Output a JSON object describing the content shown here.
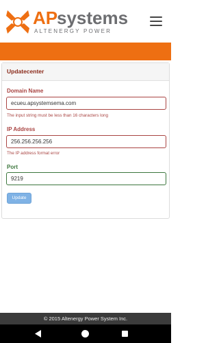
{
  "brand": {
    "name": "APsystems",
    "tagline": "ALTENERGY POWER",
    "colors": {
      "orange": "#ee6f12",
      "gray": "#6d6e71"
    }
  },
  "header": {
    "menu_icon": "hamburger-menu-icon"
  },
  "panel": {
    "title": "Updatecenter"
  },
  "form": {
    "domain": {
      "label": "Domain Name",
      "value": "ecueu.apsystemsema.com",
      "error": "The input string must be less than 16 characters long"
    },
    "ip": {
      "label": "IP Address",
      "value": "256.256.256.256",
      "error": "The IP address format error"
    },
    "port": {
      "label": "Port",
      "value": "9219"
    },
    "submit_label": "Update"
  },
  "footer": {
    "copyright": "© 2015 Altenergy Power System Inc."
  },
  "system_nav": {
    "back_icon": "back-icon",
    "home_icon": "home-icon",
    "recents_icon": "recents-icon"
  }
}
